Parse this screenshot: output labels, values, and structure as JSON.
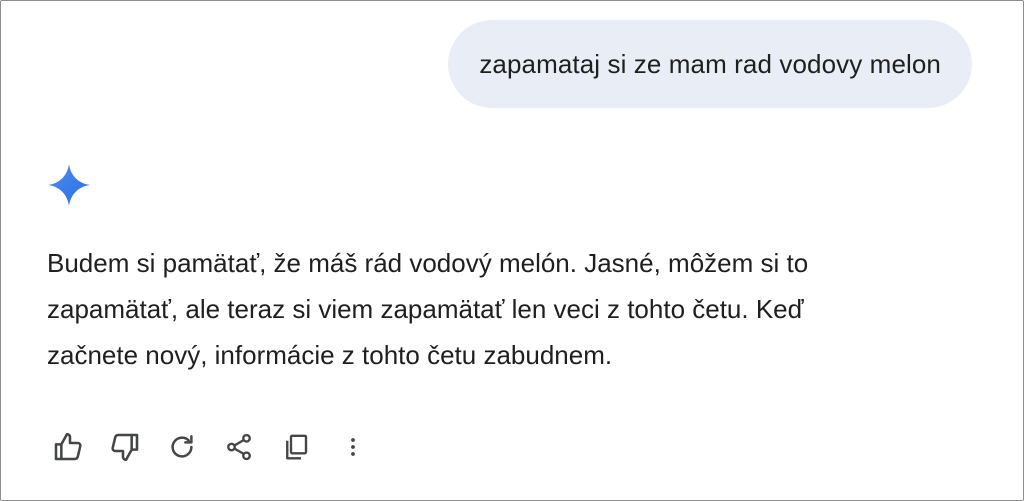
{
  "user_message": {
    "text": "zapamataj si ze mam rad vodovy melon"
  },
  "assistant": {
    "avatar_icon": "gemini-sparkle-icon",
    "accent_colors": [
      "#4285f4",
      "#1a73e8"
    ],
    "lines": [
      "Budem si pamätať, že máš rád vodový melón. Jasné, môžem si to",
      "zapamätať, ale teraz si viem zapamätať len veci z tohto četu. Keď",
      "začnete nový, informácie z tohto četu zabudnem."
    ]
  },
  "actions": [
    {
      "icon": "thumb-up-icon"
    },
    {
      "icon": "thumb-down-icon"
    },
    {
      "icon": "regenerate-icon"
    },
    {
      "icon": "share-icon"
    },
    {
      "icon": "copy-icon"
    },
    {
      "icon": "more-vert-icon"
    }
  ],
  "colors": {
    "user_bubble_bg": "#e9eef6",
    "text": "#1f1f1f",
    "icon": "#444746"
  }
}
